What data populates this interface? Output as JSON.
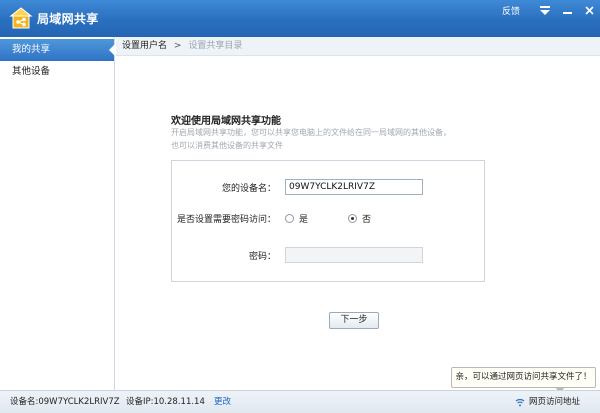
{
  "app": {
    "title": "局域网共享",
    "feedback": "反馈"
  },
  "sidebar": {
    "items": [
      {
        "label": "我的共享"
      },
      {
        "label": "其他设备"
      }
    ]
  },
  "breadcrumb": {
    "current": "设置用户名",
    "separator": ">",
    "next": "设置共享目录"
  },
  "welcome": {
    "title": "欢迎使用局域网共享功能",
    "desc_line1": "开启局域网共享功能，您可以共享您电脑上的文件给在同一局域网的其他设备，",
    "desc_line2": "也可以消费其他设备的共享文件"
  },
  "form": {
    "device_label": "您的设备名：",
    "device_value": "09W7YCLK2LRIV7Z",
    "password_q_label": "是否设置需要密码访问：",
    "option_yes": "是",
    "option_no": "否",
    "selected_option": "否",
    "password_label": "密码："
  },
  "buttons": {
    "next": "下一步"
  },
  "tooltip": {
    "text": "亲，可以通过网页访问共享文件了！"
  },
  "status": {
    "device": "设备名:09W7YCLK2LRIV7Z",
    "ip": "设备IP:10.28.11.14",
    "change": "更改",
    "web_access": "网页访问地址"
  },
  "colors": {
    "title_bar": "#2a6fbf",
    "link": "#1a62c6",
    "accent": "#2f74c5"
  }
}
